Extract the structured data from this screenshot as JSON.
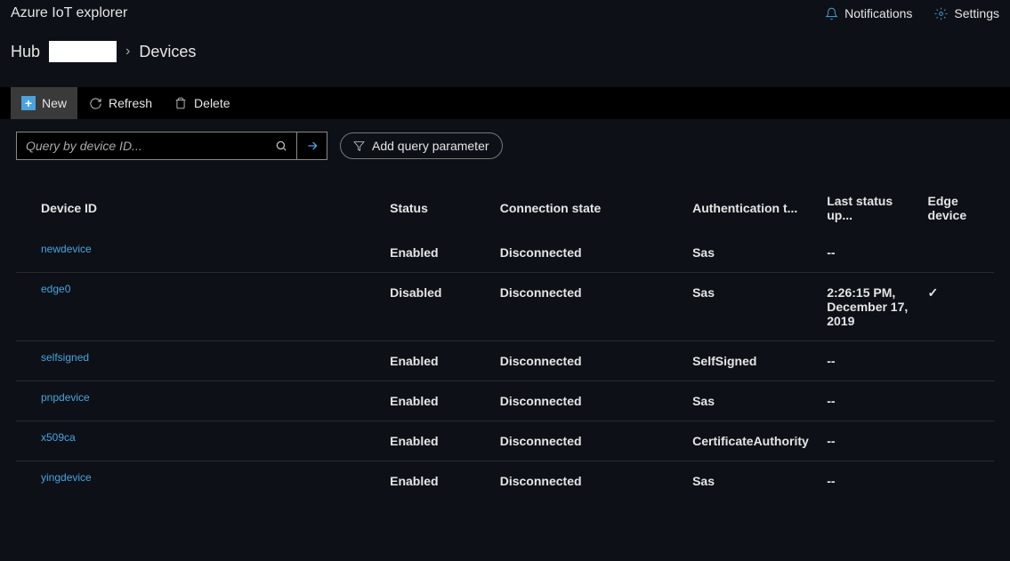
{
  "app_title": "Azure IoT explorer",
  "header": {
    "notifications": "Notifications",
    "settings": "Settings"
  },
  "breadcrumb": {
    "hub_label": "Hub",
    "hub_name": "",
    "devices": "Devices"
  },
  "toolbar": {
    "new_label": "New",
    "refresh_label": "Refresh",
    "delete_label": "Delete"
  },
  "search": {
    "placeholder": "Query by device ID...",
    "add_param": "Add query parameter"
  },
  "columns": {
    "device_id": "Device ID",
    "status": "Status",
    "connection_state": "Connection state",
    "auth_type": "Authentication t...",
    "last_update": "Last status up...",
    "edge": "Edge device"
  },
  "rows": [
    {
      "device_id": "newdevice",
      "status": "Enabled",
      "connection_state": "Disconnected",
      "auth_type": "Sas",
      "last_update": "--",
      "edge": ""
    },
    {
      "device_id": "edge0",
      "status": "Disabled",
      "connection_state": "Disconnected",
      "auth_type": "Sas",
      "last_update": "2:26:15 PM, December 17, 2019",
      "edge": "✓"
    },
    {
      "device_id": "selfsigned",
      "status": "Enabled",
      "connection_state": "Disconnected",
      "auth_type": "SelfSigned",
      "last_update": "--",
      "edge": ""
    },
    {
      "device_id": "pnpdevice",
      "status": "Enabled",
      "connection_state": "Disconnected",
      "auth_type": "Sas",
      "last_update": "--",
      "edge": ""
    },
    {
      "device_id": "x509ca",
      "status": "Enabled",
      "connection_state": "Disconnected",
      "auth_type": "CertificateAuthority",
      "last_update": "--",
      "edge": ""
    },
    {
      "device_id": "yingdevice",
      "status": "Enabled",
      "connection_state": "Disconnected",
      "auth_type": "Sas",
      "last_update": "--",
      "edge": ""
    }
  ]
}
